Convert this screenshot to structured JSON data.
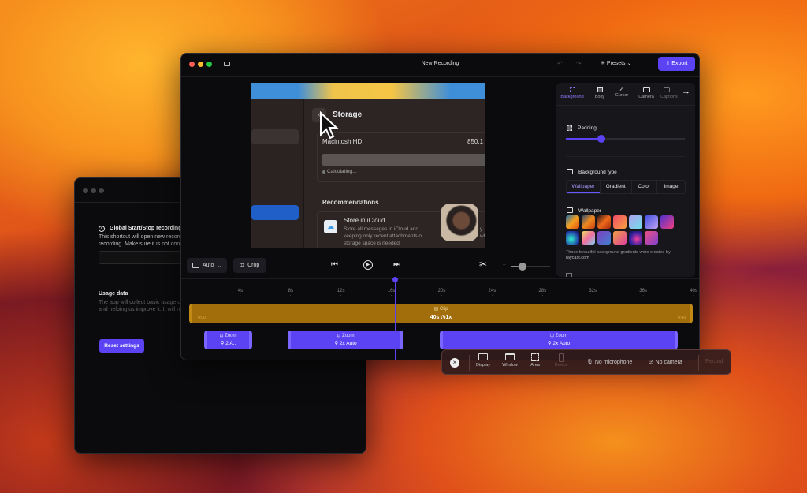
{
  "settings_window": {
    "shortcut_title": "Global Start/Stop recording s",
    "shortcut_desc_1": "This shortcut will open new recordi",
    "shortcut_desc_2": "recording. Make sure it is not confli",
    "usage_title": "Usage data",
    "usage_desc_1": "The app will collect basic usage dat",
    "usage_desc_2": "and helping us improve it. It will nev",
    "reset_label": "Reset settings"
  },
  "main_window": {
    "title": "New Recording",
    "presets_label": "Presets",
    "export_label": "Export"
  },
  "preview": {
    "storage_title": "Storage",
    "disk_name": "Macintosh HD",
    "disk_size": "850,1",
    "calculating": "Calculating...",
    "recommendations": "Recommendations",
    "icloud_title": "Store in iCloud",
    "icloud_desc_1": "Store all messages in iCloud and",
    "icloud_desc_2": "keeping only recent attachments o",
    "icloud_desc_3": "storage space is needed.",
    "icloud_desc_end_1": "y",
    "icloud_desc_end_2": "wh"
  },
  "panel": {
    "tabs": [
      "Background",
      "Body",
      "Cursor",
      "Camera",
      "Captions"
    ],
    "padding_label": "Padding",
    "padding_value": 0.3,
    "bg_type_label": "Background type",
    "bg_types": [
      "Wallpaper",
      "Gradient",
      "Color",
      "Image"
    ],
    "wallpaper_label": "Wallpaper",
    "credit_text": "Those beautiful background gradients were created by ",
    "credit_link": "raycast.com",
    "accent": "#5b42f3"
  },
  "controls": {
    "aspect_label": "Auto",
    "crop_label": "Crop",
    "zoom_value": 0.3
  },
  "timeline": {
    "ticks": [
      "4s",
      "8s",
      "12s",
      "16s",
      "20s",
      "24s",
      "28s",
      "32s",
      "36s",
      "40s"
    ],
    "clip_label": "Clip",
    "clip_duration": "40s",
    "clip_speed": "1x",
    "clip_start": "0:00",
    "clip_end": "0:40",
    "playhead_seconds": 16.3,
    "zooms": [
      {
        "label": "Zoom",
        "detail": "2 A.."
      },
      {
        "label": "Zoom",
        "detail": "2x  Auto"
      },
      {
        "label": "Zoom",
        "detail": "2x  Auto"
      }
    ]
  },
  "recorder": {
    "sources": [
      "Display",
      "Window",
      "Area",
      "Device"
    ],
    "mic_label": "No microphone",
    "camera_label": "No camera",
    "record_label": "Record"
  }
}
